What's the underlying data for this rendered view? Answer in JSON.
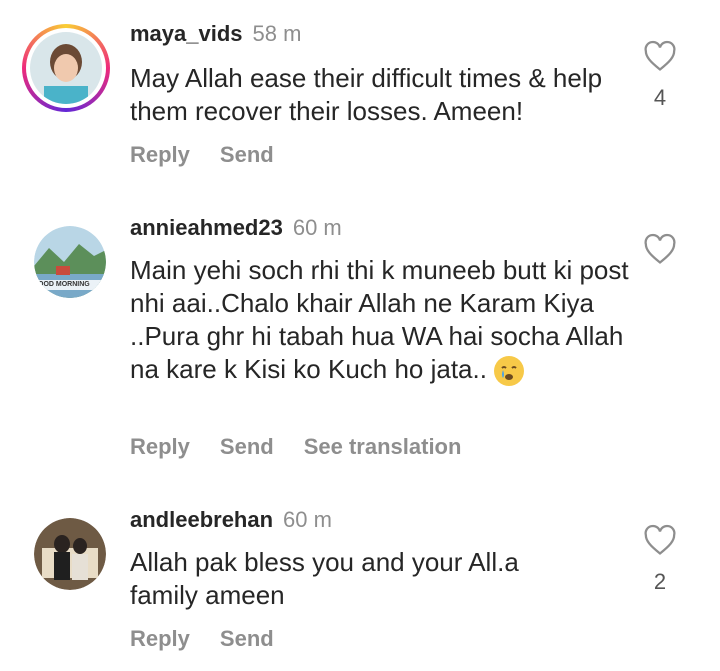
{
  "comments": [
    {
      "username": "maya_vids",
      "time": "58 m",
      "text": "May Allah ease their difficult times & help them recover their losses. Ameen!",
      "actions": [
        "Reply",
        "Send"
      ],
      "likes": "4",
      "has_story_ring": true
    },
    {
      "username": "annieahmed23",
      "time": "60 m",
      "text": "Main yehi soch rhi thi k muneeb butt ki post nhi aai..Chalo khair Allah ne Karam Kiya ..Pura ghr hi tabah hua WA hai socha Allah na kare k Kisi ko Kuch ho jata..",
      "actions": [
        "Reply",
        "Send",
        "See translation"
      ],
      "likes": "",
      "avatar_caption": "OOD MORNING",
      "has_story_ring": false
    },
    {
      "username": "andleebrehan",
      "time": "60 m",
      "text": "Allah pak bless you and your All.a family ameen",
      "actions": [
        "Reply",
        "Send"
      ],
      "likes": "2",
      "has_story_ring": false
    }
  ],
  "icons": {
    "like": "heart-outline-icon",
    "emoji": "crying-face-emoji"
  },
  "colors": {
    "text": "#262626",
    "muted": "#8e8e8e"
  }
}
